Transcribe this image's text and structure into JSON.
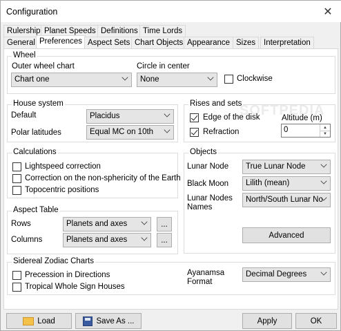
{
  "window": {
    "title": "Configuration",
    "close_glyph": "✕"
  },
  "tabs_row1": [
    "Rulership",
    "Planet Speeds",
    "Definitions",
    "Time Lords"
  ],
  "tabs_row2": [
    "General",
    "Preferences",
    "Aspect Sets",
    "Chart Objects",
    "Appearance",
    "Sizes",
    "Interpretation"
  ],
  "active_tab": "Preferences",
  "wheel": {
    "title": "Wheel",
    "outer_label": "Outer wheel chart",
    "outer_value": "Chart one",
    "circle_label": "Circle in center",
    "circle_value": "None",
    "clockwise_label": "Clockwise",
    "clockwise_checked": false
  },
  "house_system": {
    "title": "House system",
    "default_label": "Default",
    "default_value": "Placidus",
    "polar_label": "Polar latitudes",
    "polar_value": "Equal MC on 10th"
  },
  "rises_sets": {
    "title": "Rises and sets",
    "edge_label": "Edge of the disk",
    "edge_checked": true,
    "refraction_label": "Refraction",
    "refraction_checked": true,
    "altitude_label": "Altitude (m)",
    "altitude_value": "0"
  },
  "calculations": {
    "title": "Calculations",
    "items": [
      {
        "label": "Lightspeed correction",
        "checked": false
      },
      {
        "label": "Correction on the non-sphericity of the Earth",
        "checked": false
      },
      {
        "label": "Topocentric positions",
        "checked": false
      }
    ]
  },
  "objects": {
    "title": "Objects",
    "lunar_node_label": "Lunar Node",
    "lunar_node_value": "True Lunar Node",
    "black_moon_label": "Black Moon",
    "black_moon_value": "Lilith (mean)",
    "lunar_nodes_names_label_1": "Lunar Nodes",
    "lunar_nodes_names_label_2": "Names",
    "lunar_nodes_names_value": "North/South Lunar No",
    "advanced_label": "Advanced"
  },
  "aspect_table": {
    "title": "Aspect Table",
    "rows_label": "Rows",
    "rows_value": "Planets and axes",
    "columns_label": "Columns",
    "columns_value": "Planets and axes",
    "more_label": "..."
  },
  "sidereal": {
    "title": "Sidereal Zodiac Charts",
    "precession_label": "Precession in Directions",
    "precession_checked": false,
    "tropical_label": "Tropical Whole Sign Houses",
    "tropical_checked": false,
    "ayanamsa_label_1": "Ayanamsa",
    "ayanamsa_label_2": "Format",
    "ayanamsa_value": "Decimal Degrees"
  },
  "footer": {
    "load_label": "Load",
    "saveas_label": "Save As ...",
    "apply_label": "Apply",
    "ok_label": "OK"
  },
  "watermark": "SOFTPEDIA"
}
